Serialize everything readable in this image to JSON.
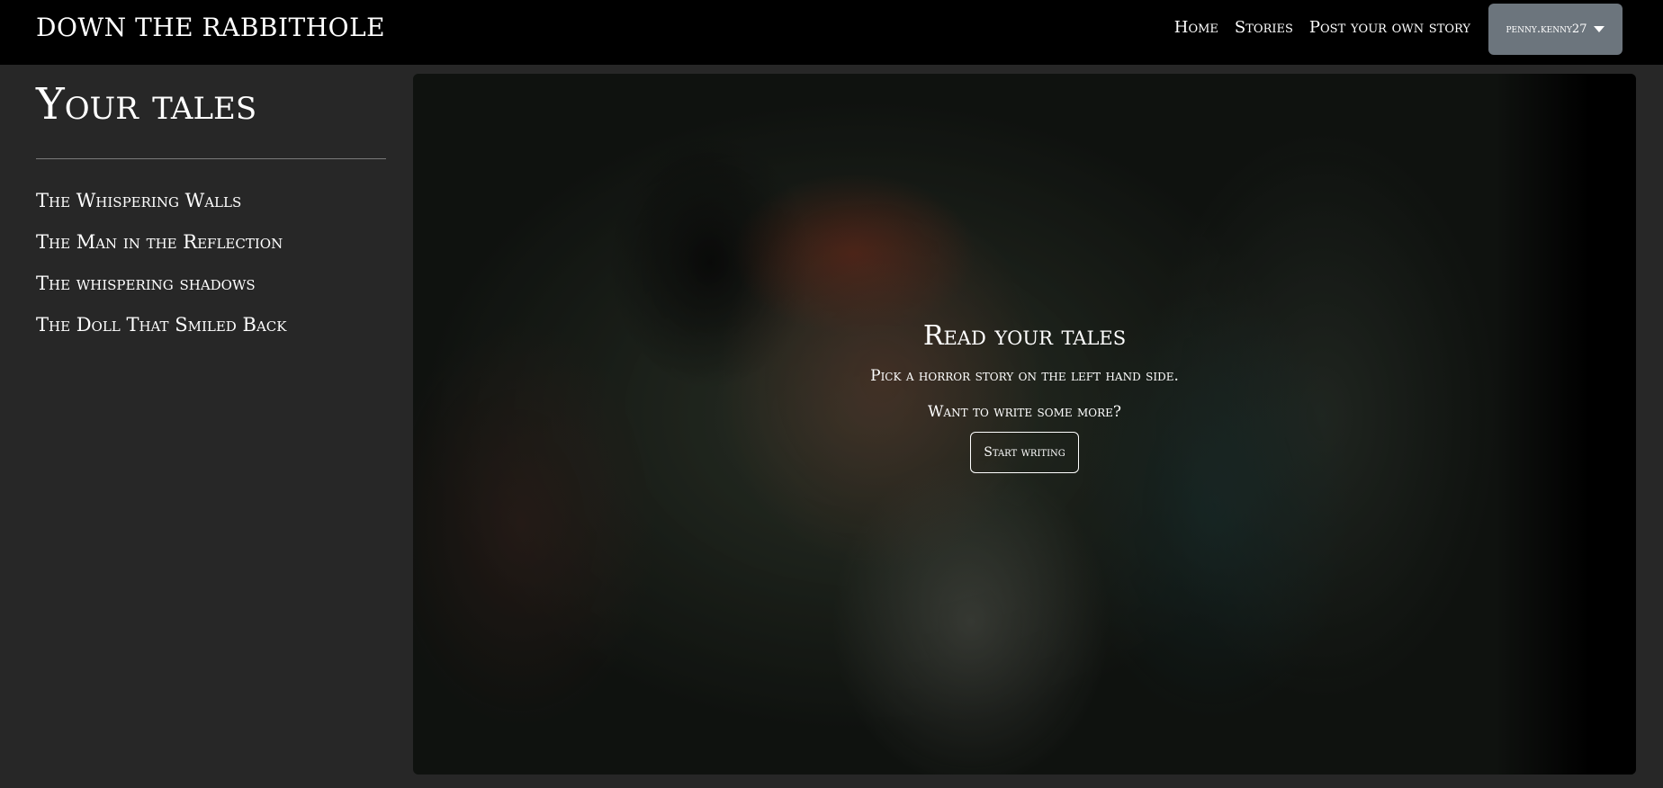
{
  "navbar": {
    "brand": "DOWN THE RABBITHOLE",
    "links": [
      "Home",
      "Stories",
      "Post your own story"
    ],
    "user": "penny.kenny27"
  },
  "sidebar": {
    "title": "Your tales",
    "stories": [
      "The Whispering Walls",
      "The Man in the Reflection",
      "The whispering shadows",
      "The Doll That Smiled Back"
    ]
  },
  "hero": {
    "title": "Read your tales",
    "text_1": "Pick a horror story on the left hand side.",
    "text_2": "Want to write some more?",
    "button_label": "Start writing"
  },
  "colors": {
    "navbar_bg": "#000000",
    "page_bg": "#272727",
    "user_button_bg": "#6c757d",
    "text": "#ffffff"
  }
}
